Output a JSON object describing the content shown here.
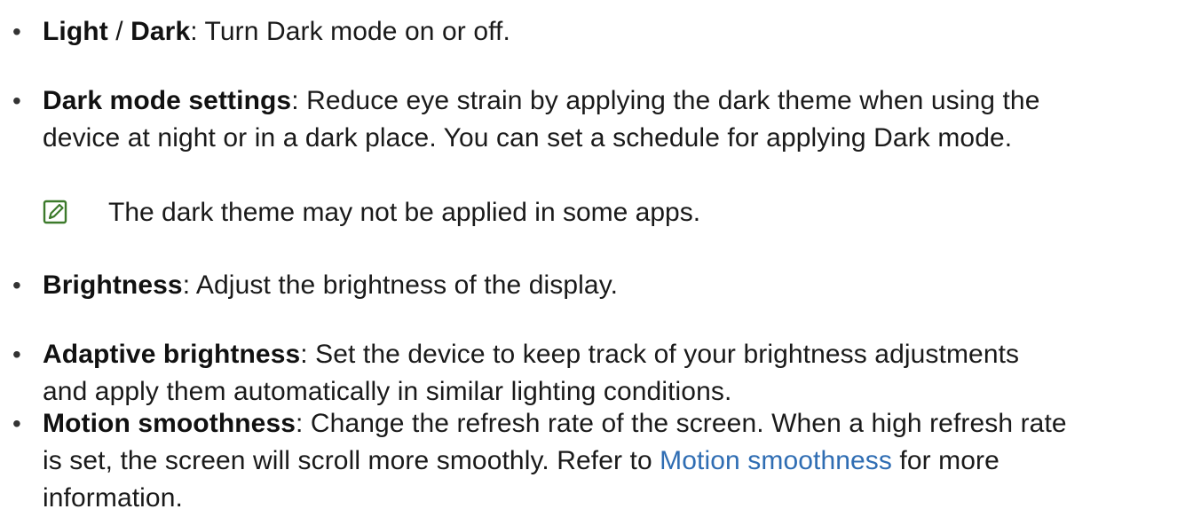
{
  "items": [
    {
      "bold": "Light",
      "sep": " / ",
      "bold2": "Dark",
      "text": ": Turn Dark mode on or off."
    },
    {
      "bold": "Dark mode settings",
      "line1": ": Reduce eye strain by applying the dark theme when using the",
      "line2": "device at night or in a dark place. You can set a schedule for applying Dark mode."
    },
    {
      "bold": "Brightness",
      "text": ": Adjust the brightness of the display."
    },
    {
      "bold": "Adaptive brightness",
      "line1": ": Set the device to keep track of your brightness adjustments",
      "line2": "and apply them automatically in similar lighting conditions."
    },
    {
      "bold": "Motion smoothness",
      "line1": ": Change the refresh rate of the screen. When a high refresh rate",
      "line2_pre": "is set, the screen will scroll more smoothly. Refer to ",
      "link": "Motion smoothness",
      "line2_post": " for more",
      "line3": "information."
    }
  ],
  "note": {
    "icon": "note-edit-icon",
    "text": "The dark theme may not be applied in some apps."
  },
  "bullet_char": "•",
  "colors": {
    "link": "#2f6db3",
    "icon": "#3c7a2b"
  }
}
